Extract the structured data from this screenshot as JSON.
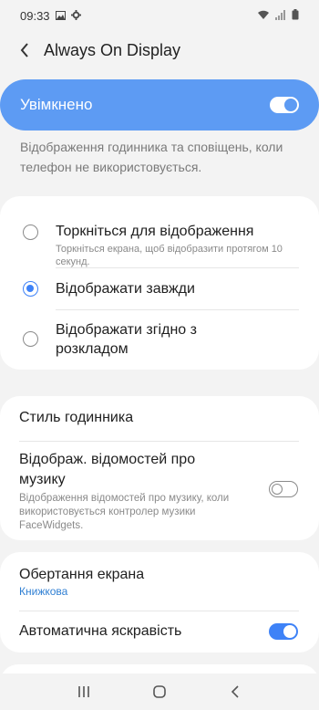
{
  "status_bar": {
    "time": "09:33"
  },
  "header": {
    "title": "Always On Display"
  },
  "master_switch": {
    "label": "Увімкнено",
    "state": "on"
  },
  "description": "Відображення годинника та сповіщень, коли телефон не використовується.",
  "mode_options": [
    {
      "title": "Торкніться для відображення",
      "subtitle": "Торкніться екрана, щоб відобразити протягом 10 секунд.",
      "selected": false
    },
    {
      "title": "Відображати завжди",
      "subtitle": "",
      "selected": true
    },
    {
      "title": "Відображати згідно з розкладом",
      "subtitle": "",
      "selected": false
    }
  ],
  "clock_style": {
    "title": "Стиль годинника"
  },
  "music_info": {
    "title": "Відображ. відомостей про музику",
    "subtitle": "Відображення відомостей про музику, коли використовується контролер музики FaceWidgets.",
    "state": "off"
  },
  "rotation": {
    "title": "Обертання екрана",
    "value": "Книжкова"
  },
  "auto_brightness": {
    "title": "Автоматична яскравість",
    "state": "on"
  },
  "colors": {
    "accent": "#3e82f7",
    "master_bg": "#5d9bf3",
    "link": "#2f7fd3",
    "background": "#f3f3f3"
  }
}
